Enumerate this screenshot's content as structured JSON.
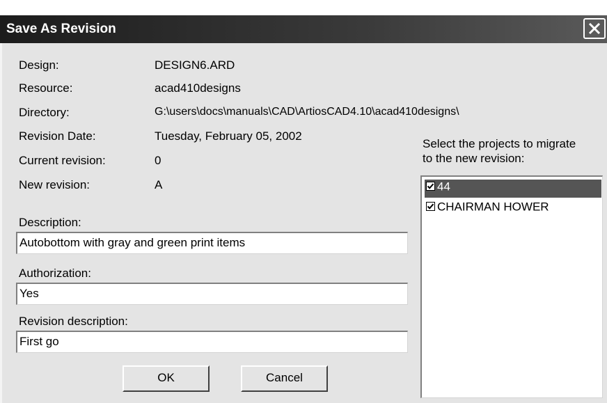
{
  "window": {
    "title": "Save As Revision"
  },
  "info": {
    "design_label": "Design:",
    "design_value": "DESIGN6.ARD",
    "resource_label": "Resource:",
    "resource_value": "acad410designs",
    "directory_label": "Directory:",
    "directory_value": "G:\\users\\docs\\manuals\\CAD\\ArtiosCAD4.10\\acad410designs\\",
    "revision_date_label": "Revision Date:",
    "revision_date_value": "Tuesday, February 05, 2002",
    "current_revision_label": "Current revision:",
    "current_revision_value": "0",
    "new_revision_label": "New revision:",
    "new_revision_value": "A"
  },
  "form": {
    "description_label": "Description:",
    "description_value": "Autobottom with gray and green print items",
    "authorization_label": "Authorization:",
    "authorization_value": "Yes",
    "revision_description_label": "Revision description:",
    "revision_description_value": "First go"
  },
  "buttons": {
    "ok_label": "OK",
    "cancel_label": "Cancel"
  },
  "projects": {
    "prompt_line1": "Select the projects to migrate",
    "prompt_line2": "to the new revision:",
    "items": [
      {
        "label": "44",
        "checked": true,
        "selected": true
      },
      {
        "label": "CHAIRMAN HOWER",
        "checked": true,
        "selected": false
      }
    ]
  },
  "colors": {
    "title_bar": "#2a2a2a",
    "dialog_bg": "#e4e4e4",
    "selection": "#555555"
  }
}
